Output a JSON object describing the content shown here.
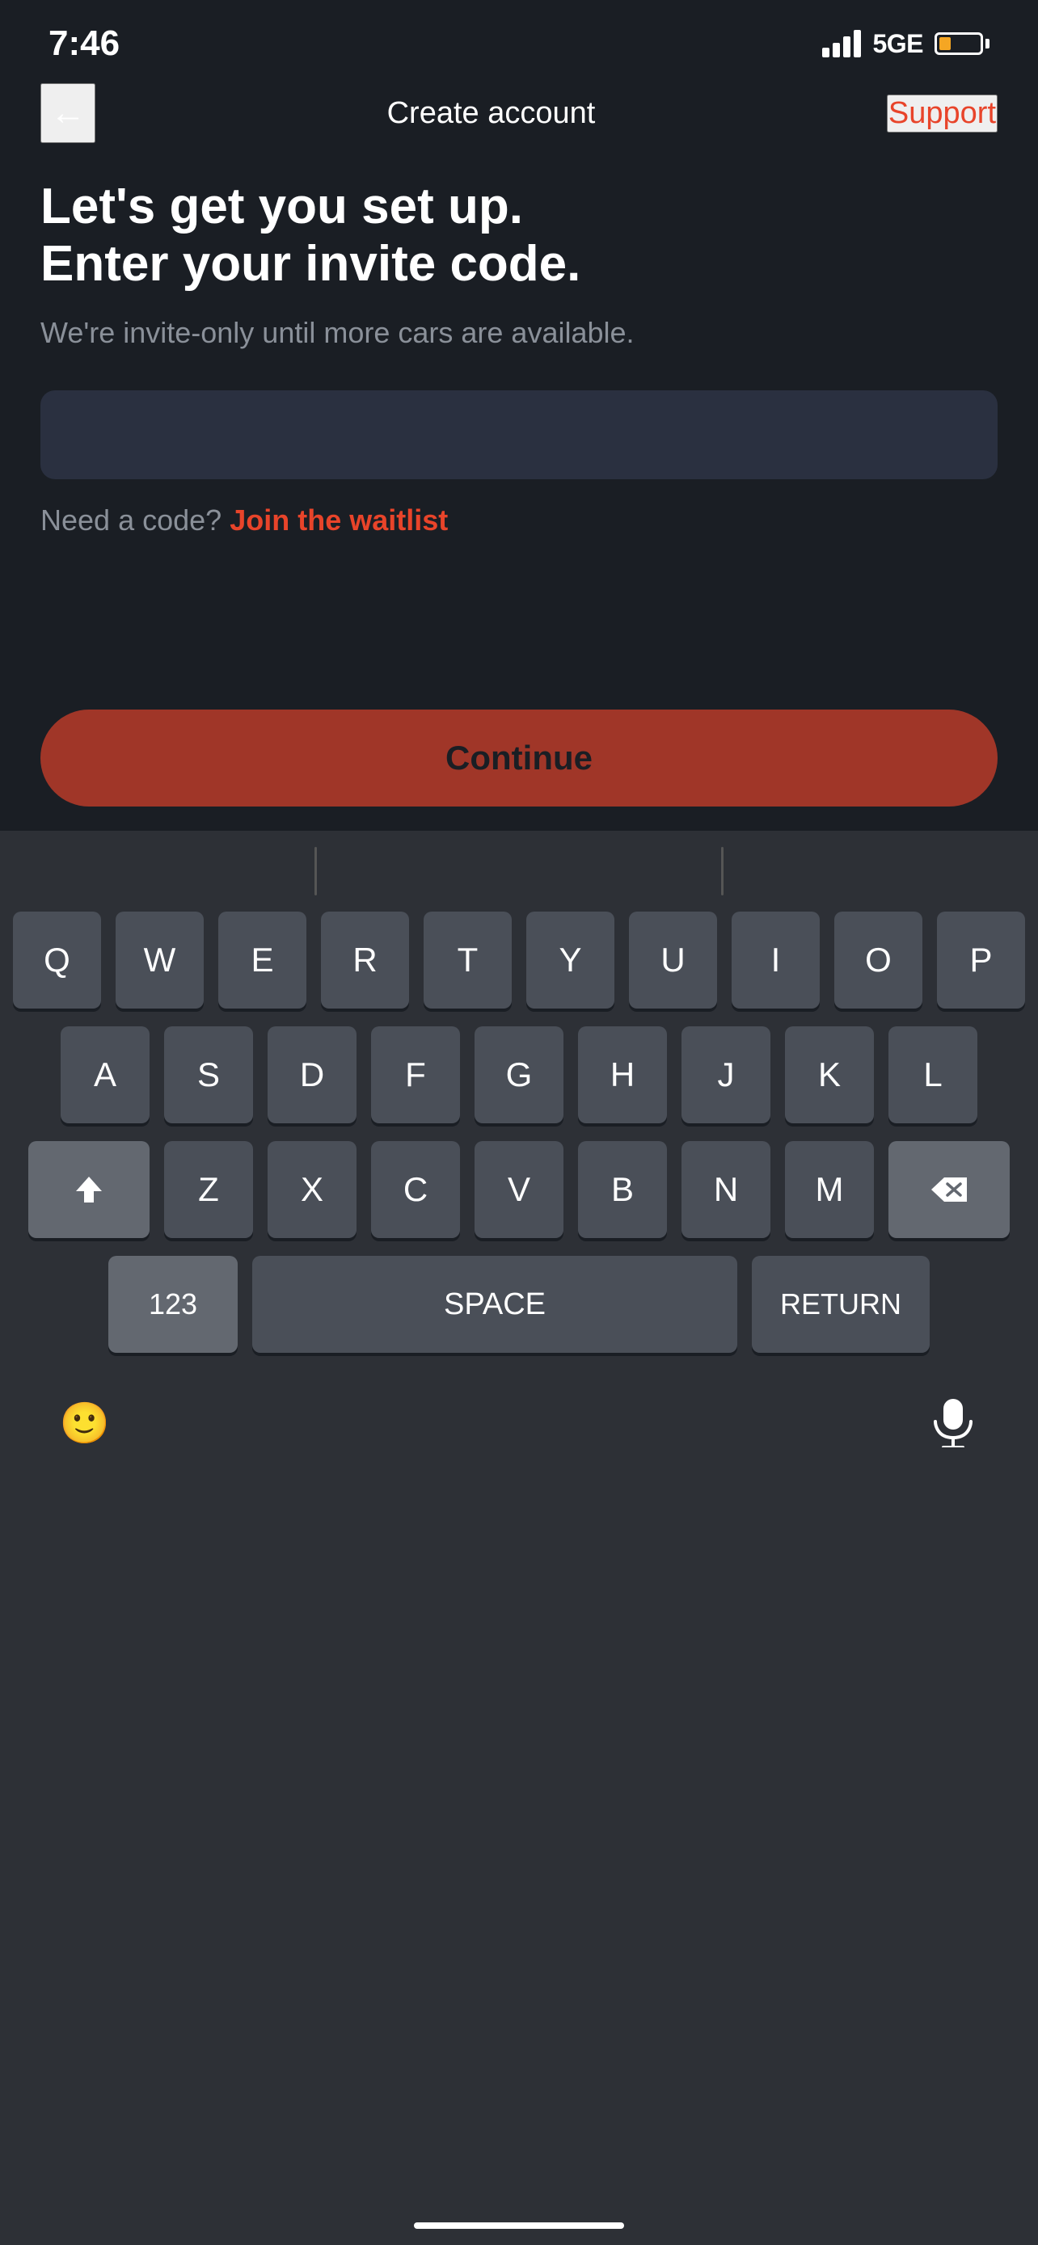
{
  "statusBar": {
    "time": "7:46",
    "network": "5GE"
  },
  "navBar": {
    "title": "Create account",
    "backLabel": "←",
    "supportLabel": "Support"
  },
  "content": {
    "headline": "Let's get you set up.\nEnter your invite code.",
    "subtext": "We're invite-only until more cars are available.",
    "inputPlaceholder": "",
    "waitlistPrefix": "Need a code?",
    "waitlistLink": "Join the waitlist"
  },
  "continueButton": {
    "label": "Continue"
  },
  "keyboard": {
    "row1": [
      "Q",
      "W",
      "E",
      "R",
      "T",
      "Y",
      "U",
      "I",
      "O",
      "P"
    ],
    "row2": [
      "A",
      "S",
      "D",
      "F",
      "G",
      "H",
      "J",
      "K",
      "L"
    ],
    "row3": [
      "Z",
      "X",
      "C",
      "V",
      "B",
      "N",
      "M"
    ],
    "numbersLabel": "123",
    "spaceLabel": "space",
    "returnLabel": "return"
  }
}
